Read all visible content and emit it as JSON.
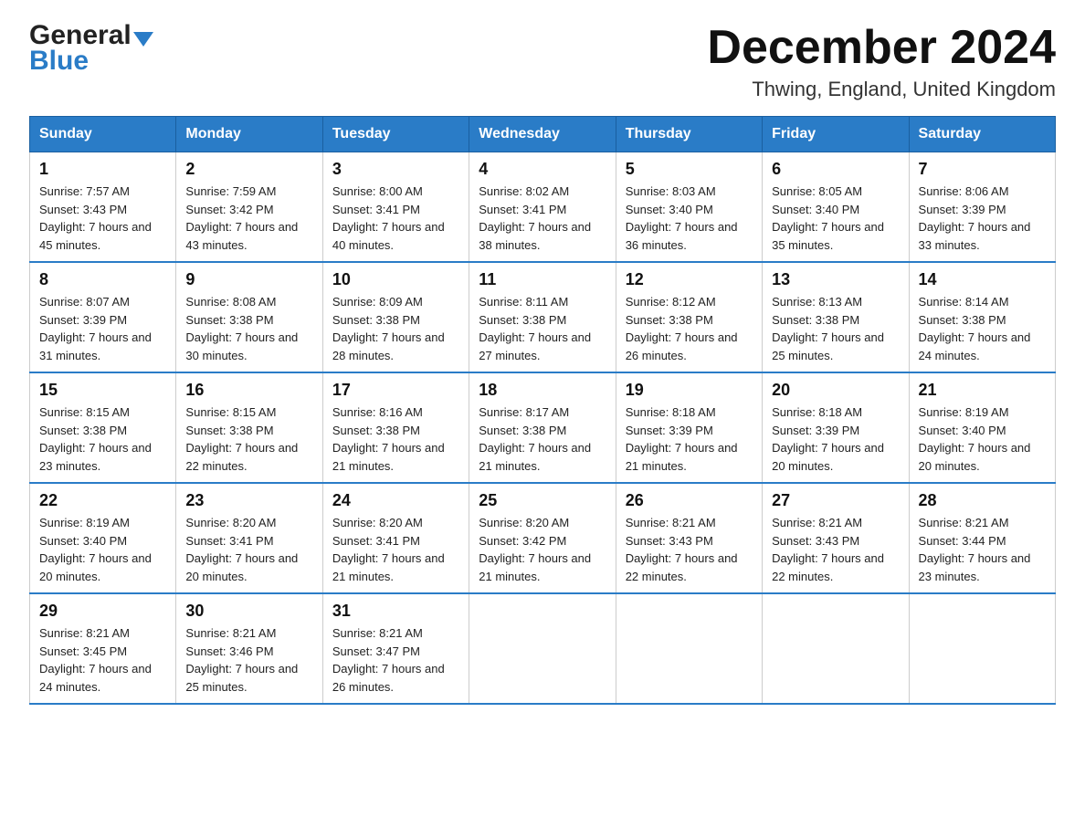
{
  "header": {
    "logo_general": "General",
    "logo_blue": "Blue",
    "title": "December 2024",
    "subtitle": "Thwing, England, United Kingdom"
  },
  "days_of_week": [
    "Sunday",
    "Monday",
    "Tuesday",
    "Wednesday",
    "Thursday",
    "Friday",
    "Saturday"
  ],
  "weeks": [
    [
      {
        "day": "1",
        "sunrise": "Sunrise: 7:57 AM",
        "sunset": "Sunset: 3:43 PM",
        "daylight": "Daylight: 7 hours and 45 minutes."
      },
      {
        "day": "2",
        "sunrise": "Sunrise: 7:59 AM",
        "sunset": "Sunset: 3:42 PM",
        "daylight": "Daylight: 7 hours and 43 minutes."
      },
      {
        "day": "3",
        "sunrise": "Sunrise: 8:00 AM",
        "sunset": "Sunset: 3:41 PM",
        "daylight": "Daylight: 7 hours and 40 minutes."
      },
      {
        "day": "4",
        "sunrise": "Sunrise: 8:02 AM",
        "sunset": "Sunset: 3:41 PM",
        "daylight": "Daylight: 7 hours and 38 minutes."
      },
      {
        "day": "5",
        "sunrise": "Sunrise: 8:03 AM",
        "sunset": "Sunset: 3:40 PM",
        "daylight": "Daylight: 7 hours and 36 minutes."
      },
      {
        "day": "6",
        "sunrise": "Sunrise: 8:05 AM",
        "sunset": "Sunset: 3:40 PM",
        "daylight": "Daylight: 7 hours and 35 minutes."
      },
      {
        "day": "7",
        "sunrise": "Sunrise: 8:06 AM",
        "sunset": "Sunset: 3:39 PM",
        "daylight": "Daylight: 7 hours and 33 minutes."
      }
    ],
    [
      {
        "day": "8",
        "sunrise": "Sunrise: 8:07 AM",
        "sunset": "Sunset: 3:39 PM",
        "daylight": "Daylight: 7 hours and 31 minutes."
      },
      {
        "day": "9",
        "sunrise": "Sunrise: 8:08 AM",
        "sunset": "Sunset: 3:38 PM",
        "daylight": "Daylight: 7 hours and 30 minutes."
      },
      {
        "day": "10",
        "sunrise": "Sunrise: 8:09 AM",
        "sunset": "Sunset: 3:38 PM",
        "daylight": "Daylight: 7 hours and 28 minutes."
      },
      {
        "day": "11",
        "sunrise": "Sunrise: 8:11 AM",
        "sunset": "Sunset: 3:38 PM",
        "daylight": "Daylight: 7 hours and 27 minutes."
      },
      {
        "day": "12",
        "sunrise": "Sunrise: 8:12 AM",
        "sunset": "Sunset: 3:38 PM",
        "daylight": "Daylight: 7 hours and 26 minutes."
      },
      {
        "day": "13",
        "sunrise": "Sunrise: 8:13 AM",
        "sunset": "Sunset: 3:38 PM",
        "daylight": "Daylight: 7 hours and 25 minutes."
      },
      {
        "day": "14",
        "sunrise": "Sunrise: 8:14 AM",
        "sunset": "Sunset: 3:38 PM",
        "daylight": "Daylight: 7 hours and 24 minutes."
      }
    ],
    [
      {
        "day": "15",
        "sunrise": "Sunrise: 8:15 AM",
        "sunset": "Sunset: 3:38 PM",
        "daylight": "Daylight: 7 hours and 23 minutes."
      },
      {
        "day": "16",
        "sunrise": "Sunrise: 8:15 AM",
        "sunset": "Sunset: 3:38 PM",
        "daylight": "Daylight: 7 hours and 22 minutes."
      },
      {
        "day": "17",
        "sunrise": "Sunrise: 8:16 AM",
        "sunset": "Sunset: 3:38 PM",
        "daylight": "Daylight: 7 hours and 21 minutes."
      },
      {
        "day": "18",
        "sunrise": "Sunrise: 8:17 AM",
        "sunset": "Sunset: 3:38 PM",
        "daylight": "Daylight: 7 hours and 21 minutes."
      },
      {
        "day": "19",
        "sunrise": "Sunrise: 8:18 AM",
        "sunset": "Sunset: 3:39 PM",
        "daylight": "Daylight: 7 hours and 21 minutes."
      },
      {
        "day": "20",
        "sunrise": "Sunrise: 8:18 AM",
        "sunset": "Sunset: 3:39 PM",
        "daylight": "Daylight: 7 hours and 20 minutes."
      },
      {
        "day": "21",
        "sunrise": "Sunrise: 8:19 AM",
        "sunset": "Sunset: 3:40 PM",
        "daylight": "Daylight: 7 hours and 20 minutes."
      }
    ],
    [
      {
        "day": "22",
        "sunrise": "Sunrise: 8:19 AM",
        "sunset": "Sunset: 3:40 PM",
        "daylight": "Daylight: 7 hours and 20 minutes."
      },
      {
        "day": "23",
        "sunrise": "Sunrise: 8:20 AM",
        "sunset": "Sunset: 3:41 PM",
        "daylight": "Daylight: 7 hours and 20 minutes."
      },
      {
        "day": "24",
        "sunrise": "Sunrise: 8:20 AM",
        "sunset": "Sunset: 3:41 PM",
        "daylight": "Daylight: 7 hours and 21 minutes."
      },
      {
        "day": "25",
        "sunrise": "Sunrise: 8:20 AM",
        "sunset": "Sunset: 3:42 PM",
        "daylight": "Daylight: 7 hours and 21 minutes."
      },
      {
        "day": "26",
        "sunrise": "Sunrise: 8:21 AM",
        "sunset": "Sunset: 3:43 PM",
        "daylight": "Daylight: 7 hours and 22 minutes."
      },
      {
        "day": "27",
        "sunrise": "Sunrise: 8:21 AM",
        "sunset": "Sunset: 3:43 PM",
        "daylight": "Daylight: 7 hours and 22 minutes."
      },
      {
        "day": "28",
        "sunrise": "Sunrise: 8:21 AM",
        "sunset": "Sunset: 3:44 PM",
        "daylight": "Daylight: 7 hours and 23 minutes."
      }
    ],
    [
      {
        "day": "29",
        "sunrise": "Sunrise: 8:21 AM",
        "sunset": "Sunset: 3:45 PM",
        "daylight": "Daylight: 7 hours and 24 minutes."
      },
      {
        "day": "30",
        "sunrise": "Sunrise: 8:21 AM",
        "sunset": "Sunset: 3:46 PM",
        "daylight": "Daylight: 7 hours and 25 minutes."
      },
      {
        "day": "31",
        "sunrise": "Sunrise: 8:21 AM",
        "sunset": "Sunset: 3:47 PM",
        "daylight": "Daylight: 7 hours and 26 minutes."
      },
      null,
      null,
      null,
      null
    ]
  ]
}
